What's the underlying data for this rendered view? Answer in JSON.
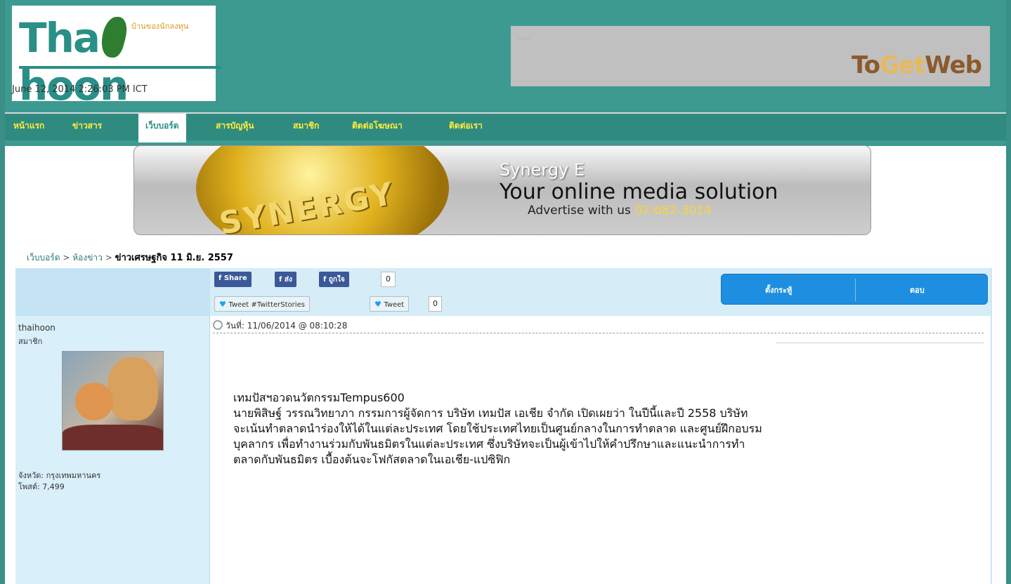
{
  "header": {
    "logo_text_left": "Tha",
    "logo_text_right": "hoon",
    "logo_tagline": "บ้านของนักลงทุน",
    "datetime": "June 12, 2014   2:26:03 PM ICT",
    "top_ad": {
      "dots": "......",
      "brand_a": "To",
      "brand_b": "Get",
      "brand_c": "Web"
    }
  },
  "nav": {
    "items": [
      {
        "label": "หน้าแรก"
      },
      {
        "label": "ข่าวสาร"
      },
      {
        "label": "เว็บบอร์ด"
      },
      {
        "label": "สารบัญหุ้น"
      },
      {
        "label": "สมาชิก"
      },
      {
        "label": "ติดต่อโฆษณา"
      },
      {
        "label": "ติดต่อเรา"
      }
    ],
    "active_index": 2
  },
  "banner": {
    "coin_text": "SYNERGY",
    "line1": "Synergy E",
    "line2": "Your online media solution",
    "line3_prefix": "Advertise with us ",
    "line3_phone": "02-682-3014"
  },
  "breadcrumb": {
    "item1": "เว็บบอร์ด",
    "sep": " > ",
    "item2": "ห้องข่าว",
    "current": "ข่าวเศรษฐกิจ 11 มิ.ย. 2557"
  },
  "social": {
    "share_label": "Share",
    "send_label": "ส่ง",
    "like_label": "ถูกใจ",
    "like_count": "0",
    "tweet_stories_label": "Tweet #TwitterStories",
    "tweet_label": "Tweet",
    "tweet_count": "0"
  },
  "actions": {
    "new_topic": "ตั้งกระทู้",
    "reply": "ตอบ"
  },
  "user": {
    "name": "thaihoon",
    "role": "สมาชิก",
    "province": "จังหวัด: กรุงเทพมหานคร",
    "posts": "โพสต์: 7,499"
  },
  "post": {
    "date": "วันที่: 11/06/2014 @ 08:10:28",
    "title": "เทมปัสฯอวดนวัตกรรมTempus600",
    "lines": [
      "นายพิสิษฐ์ วรรณวิทยาภา กรรมการผู้จัดการ บริษัท เทมปัส เอเชีย จำกัด เปิดเผยว่า ในปีนี้และปี 2558 บริษัท",
      "จะเน้นทำตลาดนำร่องให้ได้ในแต่ละประเทศ โดยใช้ประเทศไทยเป็นศูนย์กลางในการทำตลาด และศูนย์ฝึกอบรม",
      "บุคลากร เพื่อทำงานร่วมกับพันธมิตรในแต่ละประเทศ ซึ่งบริษัทจะเป็นผู้เข้าไปให้คำปรึกษาและแนะนำการทำ",
      "ตลาดกับพันธมิตร เบื้องต้นจะโฟกัสตลาดในเอเชีย-แปซิฟิก"
    ]
  }
}
